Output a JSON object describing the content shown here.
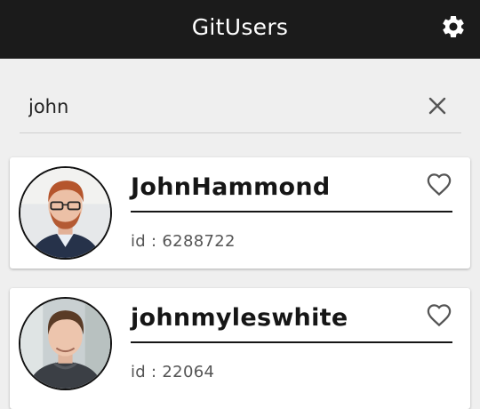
{
  "appbar": {
    "title": "GitUsers",
    "settings_icon": "gear-icon",
    "background": "#1b1b1b"
  },
  "search": {
    "value": "john",
    "placeholder": "",
    "clear_icon": "close-icon"
  },
  "users": [
    {
      "username": "JohnHammond",
      "id_text": "id : 6288722",
      "favorite_icon": "heart-outline-icon"
    },
    {
      "username": "johnmyleswhite",
      "id_text": "id : 22064",
      "favorite_icon": "heart-outline-icon"
    }
  ]
}
